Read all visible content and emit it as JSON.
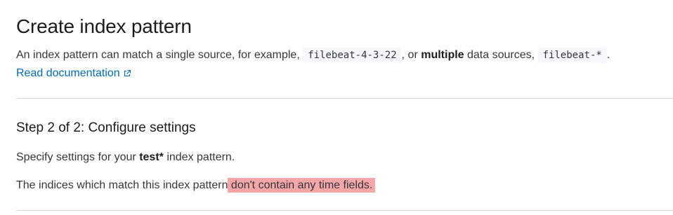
{
  "header": {
    "title": "Create index pattern",
    "intro_part1": "An index pattern can match a single source, for example, ",
    "example_single": "filebeat-4-3-22",
    "intro_part2": ", or ",
    "intro_bold": "multiple",
    "intro_part3": " data sources, ",
    "example_multiple": "filebeat-*",
    "intro_end": ".",
    "doc_link": "Read documentation"
  },
  "step": {
    "title": "Step 2 of 2: Configure settings",
    "specify_part1": "Specify settings for your ",
    "pattern_name": "test*",
    "specify_part2": " index pattern.",
    "indices_plain": "The indices which match this index pattern",
    "indices_highlight": " don't contain any time fields."
  },
  "colors": {
    "link": "#006bb4",
    "highlight": "#f5a7a7",
    "divider": "#d3dae6"
  },
  "icons": {
    "doc_link_icon": "external-link-icon"
  }
}
